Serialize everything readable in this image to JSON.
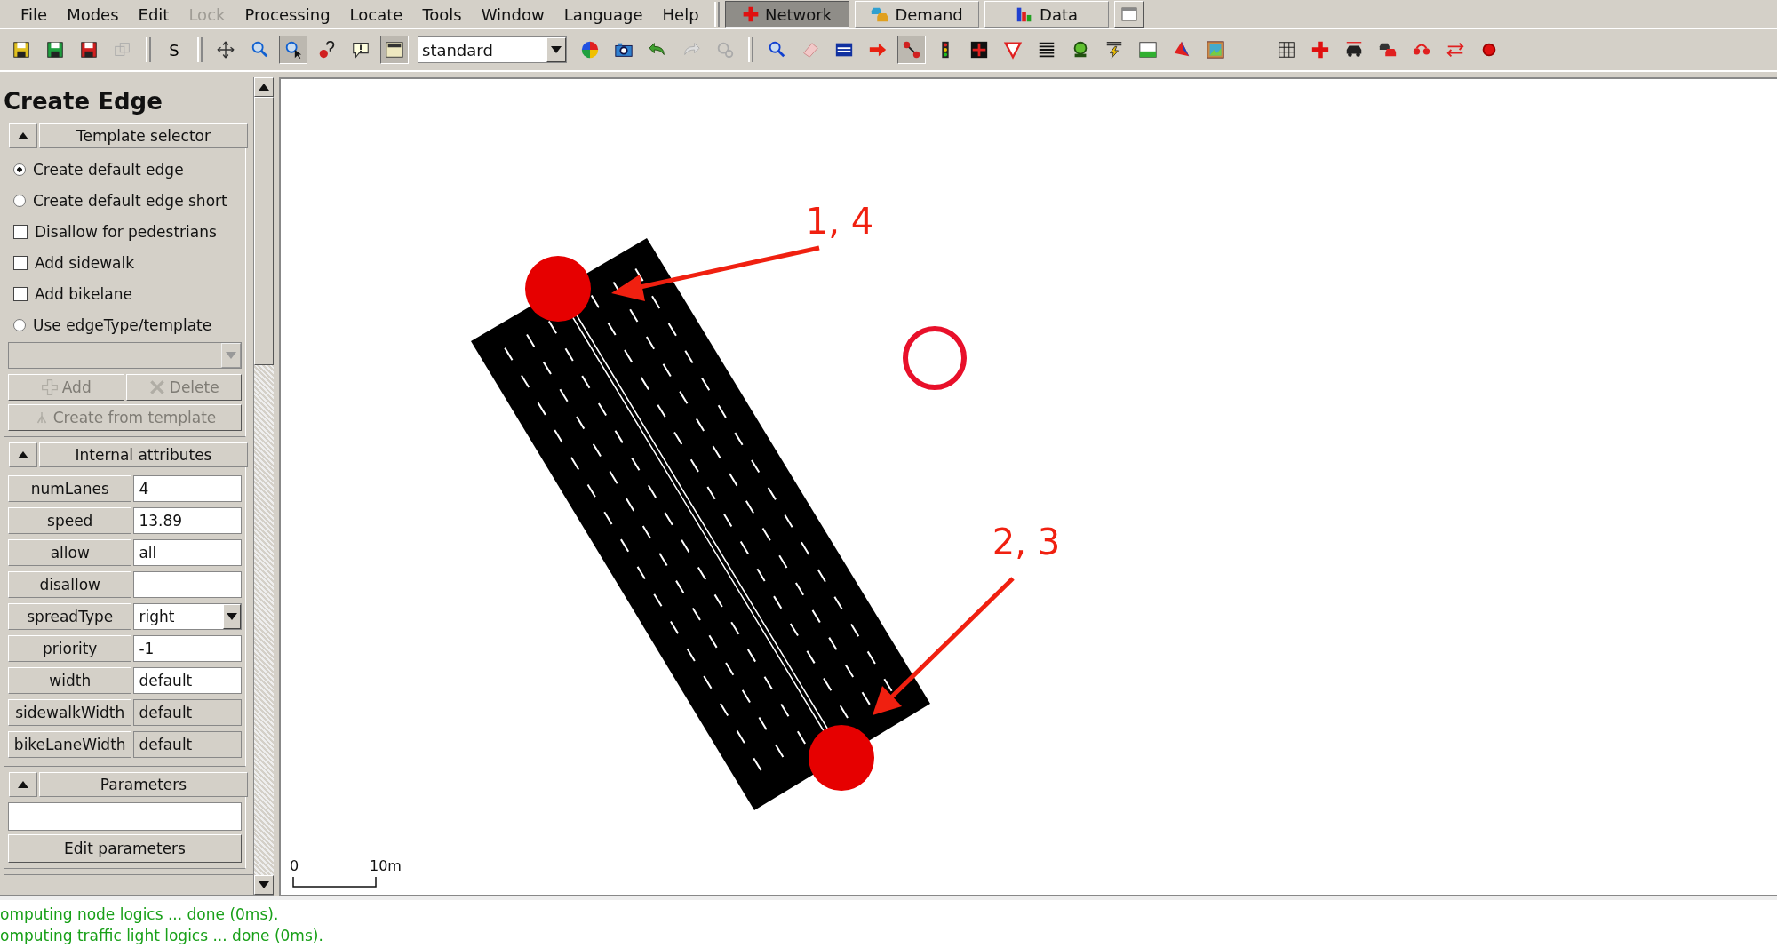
{
  "menu": [
    {
      "label": "File",
      "disabled": false
    },
    {
      "label": "Modes",
      "disabled": false
    },
    {
      "label": "Edit",
      "disabled": false
    },
    {
      "label": "Lock",
      "disabled": true
    },
    {
      "label": "Processing",
      "disabled": false
    },
    {
      "label": "Locate",
      "disabled": false
    },
    {
      "label": "Tools",
      "disabled": false
    },
    {
      "label": "Window",
      "disabled": false
    },
    {
      "label": "Language",
      "disabled": false
    },
    {
      "label": "Help",
      "disabled": false
    }
  ],
  "mode_tabs": [
    {
      "label": "Network",
      "selected": true
    },
    {
      "label": "Demand",
      "selected": false
    },
    {
      "label": "Data",
      "selected": false
    }
  ],
  "toolbar": {
    "s_button": "S",
    "view_scheme": "standard"
  },
  "panel": {
    "title": "Create Edge",
    "template_selector": {
      "title": "Template selector",
      "options": [
        {
          "kind": "radio",
          "label": "Create default edge",
          "checked": true
        },
        {
          "kind": "radio",
          "label": "Create default edge short",
          "checked": false
        },
        {
          "kind": "checkbox",
          "label": "Disallow for pedestrians",
          "checked": false
        },
        {
          "kind": "checkbox",
          "label": "Add sidewalk",
          "checked": false
        },
        {
          "kind": "checkbox",
          "label": "Add bikelane",
          "checked": false
        },
        {
          "kind": "radio",
          "label": "Use edgeType/template",
          "checked": false
        }
      ],
      "buttons": [
        {
          "label": "Add",
          "disabled": true
        },
        {
          "label": "Delete",
          "disabled": true
        },
        {
          "label": "Create from template",
          "disabled": true
        }
      ]
    },
    "internal_attributes": {
      "title": "Internal attributes",
      "rows": [
        {
          "label": "numLanes",
          "value": "4",
          "kind": "text"
        },
        {
          "label": "speed",
          "value": "13.89",
          "kind": "text"
        },
        {
          "label": "allow",
          "value": "all",
          "kind": "text"
        },
        {
          "label": "disallow",
          "kind": "text"
        },
        {
          "label": "spreadType",
          "value": "right",
          "kind": "combo"
        },
        {
          "label": "priority",
          "value": "-1",
          "kind": "text"
        },
        {
          "label": "width",
          "value": "default",
          "kind": "text"
        },
        {
          "label": "sidewalkWidth",
          "value": "default",
          "kind": "readonly"
        },
        {
          "label": "bikeLaneWidth",
          "value": "default",
          "kind": "readonly"
        }
      ]
    },
    "parameters": {
      "title": "Parameters",
      "button": "Edit parameters"
    }
  },
  "canvas": {
    "labels": [
      "1, 4",
      "2, 3"
    ],
    "scale": {
      "start": "0",
      "end": "10m"
    }
  },
  "status_lines": [
    "omputing node logics ... done (0ms).",
    "omputing traffic light logics ... done (0ms)."
  ]
}
